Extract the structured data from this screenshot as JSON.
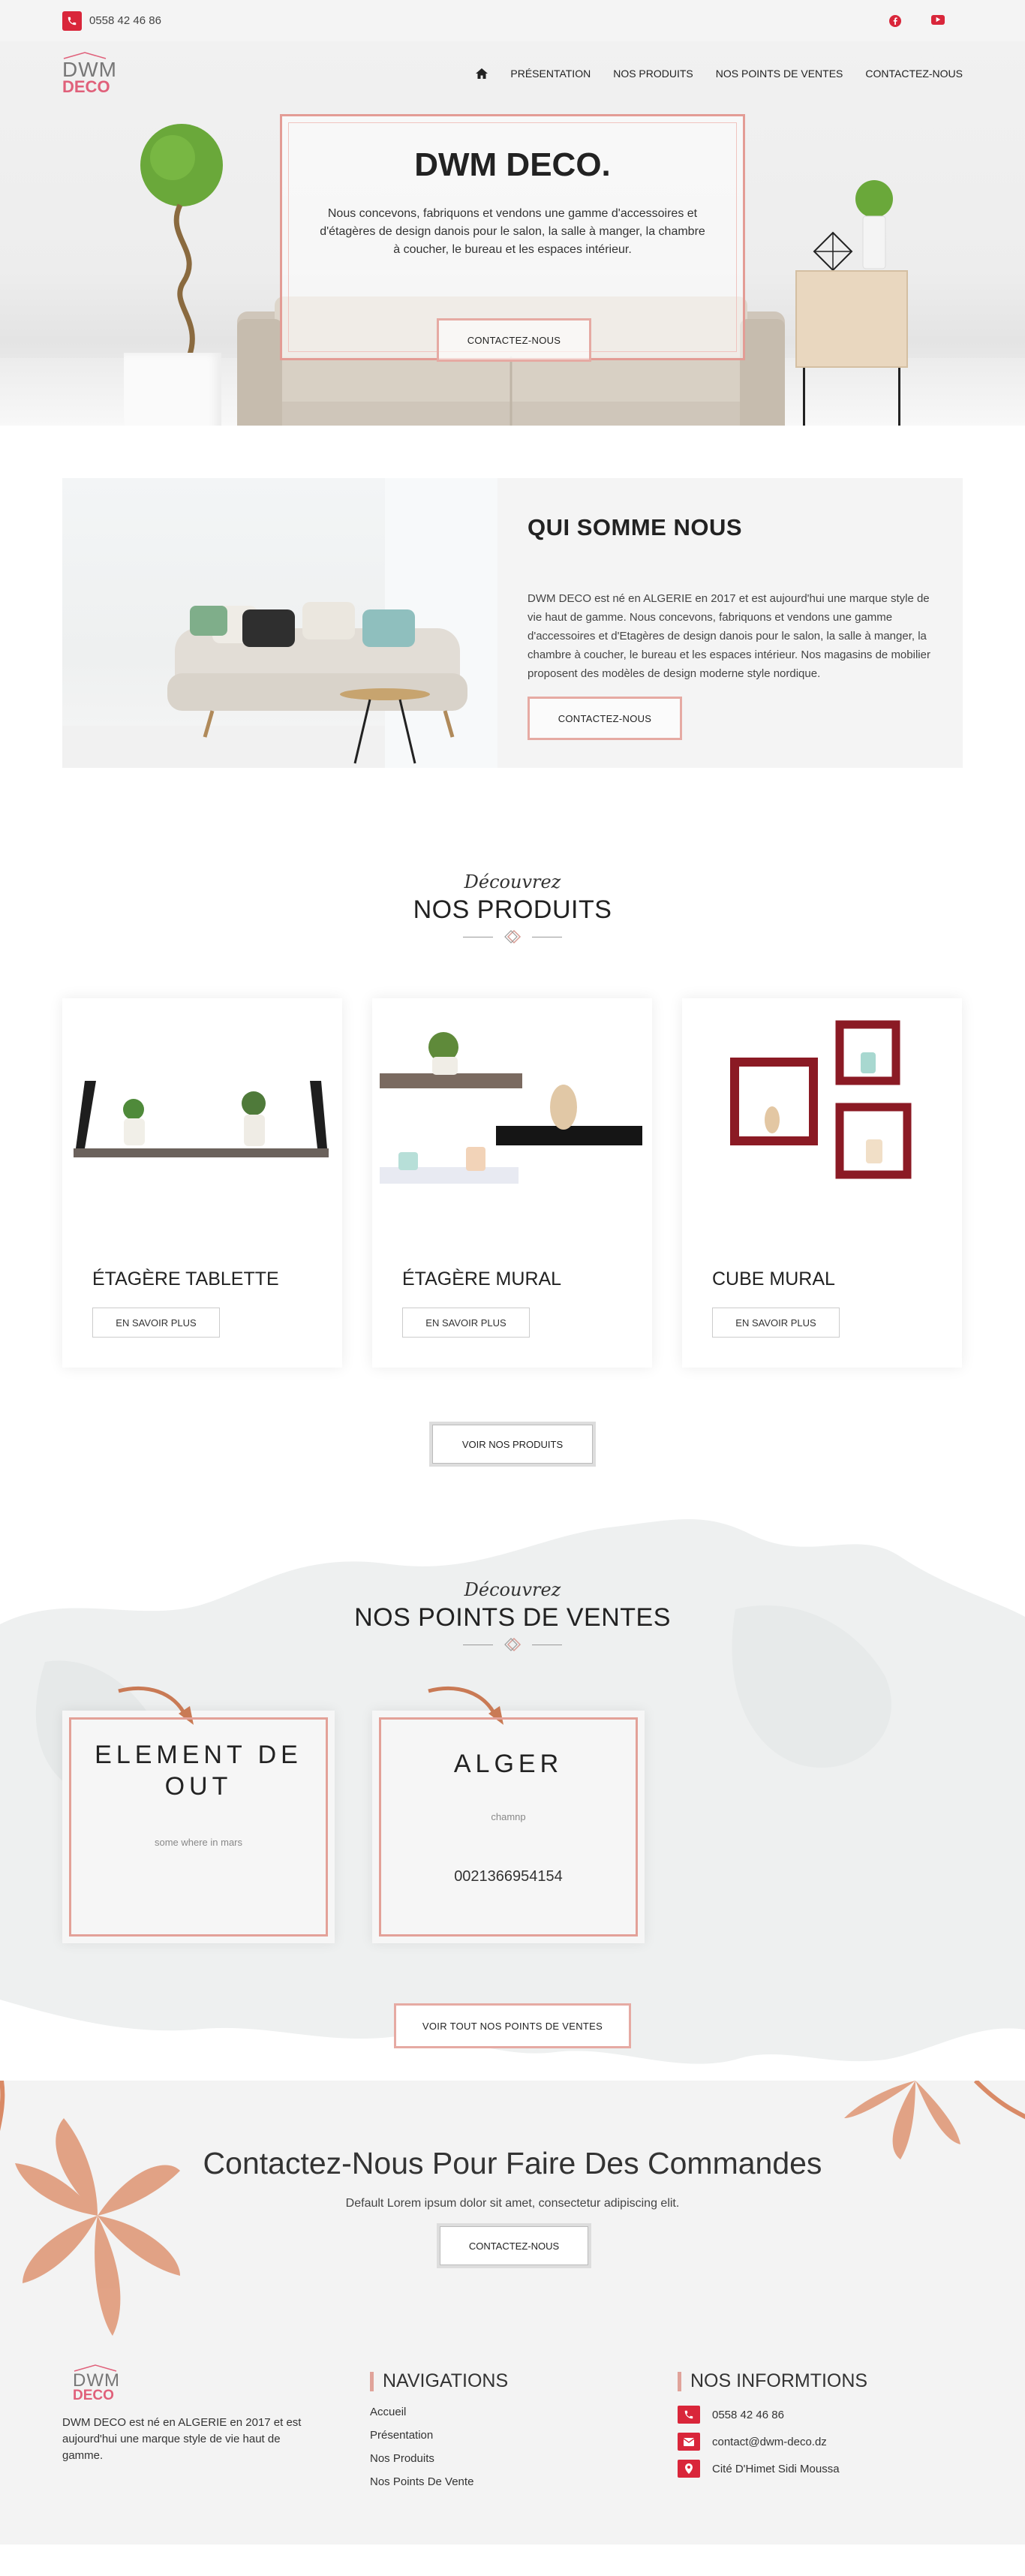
{
  "topbar": {
    "phone": "0558 42 46 86"
  },
  "nav": {
    "logo_top": "DWM",
    "logo_bottom": "DECO",
    "items": [
      "PRÉSENTATION",
      "NOS PRODUITS",
      "NOS POINTS DE VENTES",
      "CONTACTEZ-NOUS"
    ]
  },
  "hero": {
    "title": "DWM DECO.",
    "text": "Nous concevons, fabriquons et vendons une gamme d'accessoires et d'étagères de design danois pour le salon, la salle à manger, la chambre à coucher, le bureau et les espaces intérieur.",
    "button": "CONTACTEZ-NOUS"
  },
  "about": {
    "title": "QUI SOMME NOUS",
    "text": "DWM DECO est né en ALGERIE en 2017 et est aujourd'hui une marque style de vie haut de gamme. Nous concevons, fabriquons et vendons une gamme d'accessoires et d'Etagères de design danois pour le salon, la salle à manger, la chambre à coucher, le bureau et les espaces intérieur. Nos magasins de mobilier proposent des modèles de design moderne style nordique.",
    "button": "CONTACTEZ-NOUS"
  },
  "products": {
    "pre": "Découvrez",
    "title": "NOS PRODUITS",
    "items": [
      {
        "name": "ÉTAGÈRE TABLETTE",
        "button": "EN SAVOIR PLUS"
      },
      {
        "name": "ÉTAGÈRE MURAL",
        "button": "EN SAVOIR PLUS"
      },
      {
        "name": "CUBE MURAL",
        "button": "EN SAVOIR PLUS"
      }
    ],
    "all_button": "VOIR NOS PRODUITS"
  },
  "points": {
    "pre": "Découvrez",
    "title": "NOS POINTS DE VENTES",
    "items": [
      {
        "name": "ELEMENT DE OUT",
        "address": "some where in mars",
        "phone": ""
      },
      {
        "name": "ALGER",
        "address": "chamnp",
        "phone": "0021366954154"
      }
    ],
    "all_button": "VOIR TOUT NOS POINTS DE VENTES"
  },
  "cta": {
    "title": "Contactez-Nous Pour Faire Des Commandes",
    "text": "Default Lorem ipsum dolor sit amet, consectetur adipiscing elit.",
    "button": "CONTACTEZ-NOUS"
  },
  "footer": {
    "logo_top": "DWM",
    "logo_bottom": "DECO",
    "description": "DWM DECO est né en ALGERIE en 2017 et est aujourd'hui une marque style de vie haut de gamme.",
    "nav_title": "NAVIGATIONS",
    "links": [
      "Accueil",
      "Présentation",
      "Nos Produits",
      "Nos Points De Vente"
    ],
    "info_title": "NOS INFORMTIONS",
    "phone": "0558 42 46 86",
    "email": "contact@dwm-deco.dz",
    "address": "Cité D'Himet Sidi Moussa"
  },
  "colors": {
    "accent": "#d9263a",
    "frame": "#e39c95",
    "logo_pink": "#e0607a"
  },
  "icons": [
    "phone-icon",
    "facebook-icon",
    "youtube-icon",
    "home-icon",
    "email-icon",
    "map-pin-icon"
  ]
}
